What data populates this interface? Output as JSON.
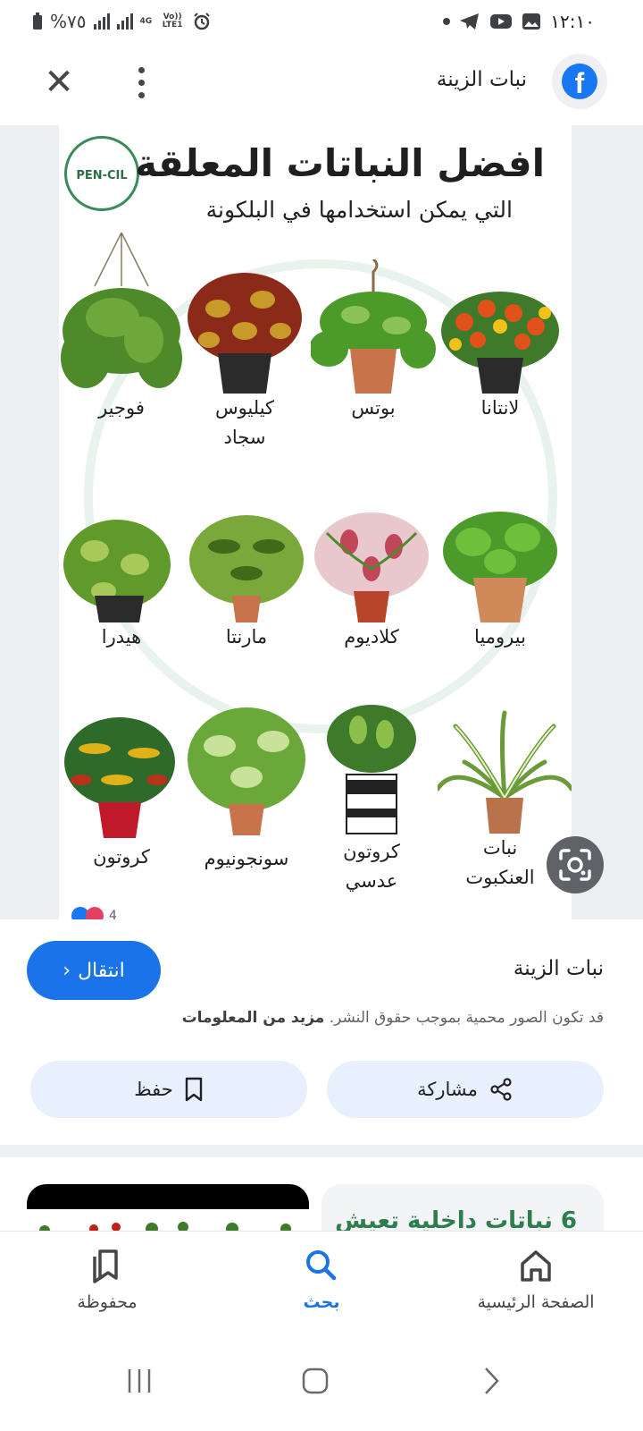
{
  "status_bar": {
    "time": "١٢:١٠",
    "battery": "%٧٥",
    "network_4g": "4G",
    "volte": "Vo)) LTE1"
  },
  "header": {
    "title": "نبات الزينة",
    "app_icon": "facebook-logo",
    "close_icon": "close-icon",
    "menu_icon": "more-vertical-icon"
  },
  "poster": {
    "logo_text": "PEN-CIL",
    "title": "افضل النباتات المعلقة",
    "subtitle": "التي يمكن استخدامها في البلكونة",
    "plants": [
      {
        "label": "فوجير"
      },
      {
        "label": "كيليوس\nسجاد"
      },
      {
        "label": "بوتس"
      },
      {
        "label": "لانتانا"
      },
      {
        "label": "هيدرا"
      },
      {
        "label": "مارنتا"
      },
      {
        "label": "كلاديوم"
      },
      {
        "label": "بيروميا"
      },
      {
        "label": "كروتون"
      },
      {
        "label": "سونجونيوم"
      },
      {
        "label": "كروتون\nعدسي"
      },
      {
        "label": "نبات\nالعنكبوت"
      }
    ],
    "reaction_count": "4"
  },
  "info": {
    "title": "نبات الزينة",
    "visit_label": "انتقال",
    "copyright_note": "قد تكون الصور محمية بموجب حقوق النشر.",
    "more_info": "مزيد من المعلومات",
    "share_label": "مشاركة",
    "save_label": "حفظ"
  },
  "related": {
    "right_card_text": "6 نباتات داخلية تعيش"
  },
  "bottom_nav": {
    "items": [
      {
        "label": "محفوظة",
        "icon": "bookmarks-icon"
      },
      {
        "label": "بحث",
        "icon": "search-icon",
        "active": true
      },
      {
        "label": "الصفحة الرئيسية",
        "icon": "home-icon"
      }
    ]
  },
  "colors": {
    "accent": "#1a73e8",
    "pill_bg": "#e8f0fe",
    "facebook": "#1877f2"
  }
}
